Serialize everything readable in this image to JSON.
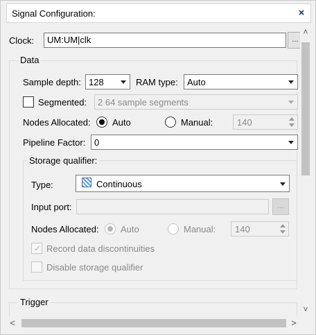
{
  "window": {
    "title": "Signal Configuration:",
    "close_glyph": "×"
  },
  "clock": {
    "label": "Clock:",
    "value": "UM:UM|clk",
    "browse_label": "..."
  },
  "data_group": {
    "title": "Data",
    "sample_depth": {
      "label": "Sample depth:",
      "value": "128"
    },
    "ram_type": {
      "label": "RAM type:",
      "value": "Auto"
    },
    "segmented": {
      "label": "Segmented:",
      "checked": false,
      "value": "2  64 sample segments"
    },
    "nodes_allocated": {
      "label": "Nodes Allocated:",
      "auto_label": "Auto",
      "manual_label": "Manual:",
      "selected": "Auto",
      "manual_value": "140"
    },
    "pipeline_factor": {
      "label": "Pipeline Factor:",
      "value": "0"
    }
  },
  "storage_qualifier": {
    "title": "Storage qualifier:",
    "type": {
      "label": "Type:",
      "value": "Continuous",
      "icon": "continuous-pattern-icon"
    },
    "input_port": {
      "label": "Input port:",
      "value": "",
      "browse_label": "..."
    },
    "nodes_allocated": {
      "label": "Nodes Allocated:",
      "auto_label": "Auto",
      "manual_label": "Manual:",
      "selected": "Auto",
      "manual_value": "140"
    },
    "record_discontinuities": {
      "label": "Record data discontinuities",
      "checked": true
    },
    "disable_storage_qualifier": {
      "label": "Disable storage qualifier",
      "checked": false
    }
  },
  "trigger_group": {
    "title": "Trigger"
  },
  "scroll": {
    "up": "˄",
    "down": "˅",
    "left": "<",
    "right": ">"
  }
}
